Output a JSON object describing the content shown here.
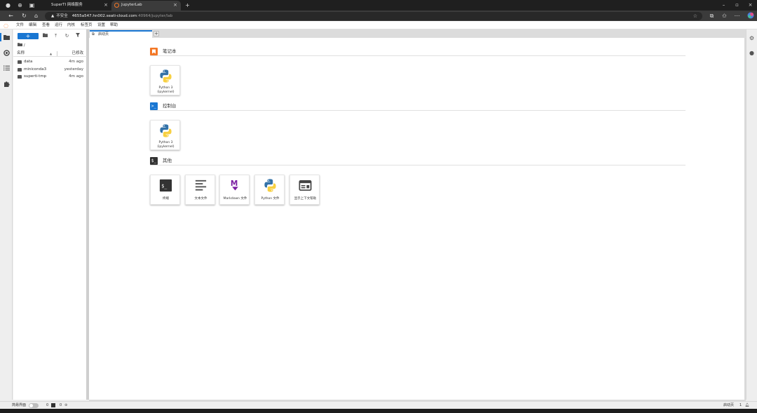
{
  "browser": {
    "tabs": [
      {
        "title": "SuperTI 网络服务",
        "active": false
      },
      {
        "title": "JupyterLab",
        "active": true
      }
    ],
    "new_tab_glyph": "+",
    "close_glyph": "×",
    "url": {
      "security_text": "不安全",
      "host": "4655a547.hn002.seati-cloud.com",
      "path": ":40964/jupyter/lab"
    },
    "window_controls": [
      "–",
      "▫",
      "×"
    ]
  },
  "jupyter": {
    "menu": [
      "文件",
      "编辑",
      "查看",
      "运行",
      "内核",
      "标签页",
      "设置",
      "帮助"
    ],
    "file_browser": {
      "new_button": "+",
      "breadcrumb": "/",
      "header": {
        "name": "名称",
        "modified": "已修改"
      },
      "files": [
        {
          "name": "data",
          "modified": "4m ago"
        },
        {
          "name": "miniconda3",
          "modified": "yesterday"
        },
        {
          "name": "superti-tmp",
          "modified": "4m ago"
        }
      ]
    },
    "tab": {
      "title": "启动页",
      "add": "+"
    },
    "launcher": {
      "sections": [
        {
          "title": "笔记本",
          "icon": "bookmark-icon",
          "cards": [
            {
              "label": "Python 3 (ipykernel)"
            }
          ]
        },
        {
          "title": "控制台",
          "icon": "console-icon",
          "cards": [
            {
              "label": "Python 3 (ipykernel)"
            }
          ]
        },
        {
          "title": "其他",
          "icon": "terminal-icon",
          "cards": [
            {
              "label": "终端"
            },
            {
              "label": "文本文件"
            },
            {
              "label": "Markdown 文件"
            },
            {
              "label": "Python 文件"
            },
            {
              "label": "显示上下文帮助"
            }
          ]
        }
      ]
    },
    "status": {
      "simple_mode": "简易界面",
      "kernels": "0",
      "terminals": "0",
      "right_text": "启动页",
      "right_count": "1"
    },
    "colors": {
      "accent": "#1976d2",
      "notebook_icon": "#f37726",
      "console_icon": "#1976d2",
      "terminal_icon": "#333333",
      "markdown": "#7b1fa2"
    }
  }
}
